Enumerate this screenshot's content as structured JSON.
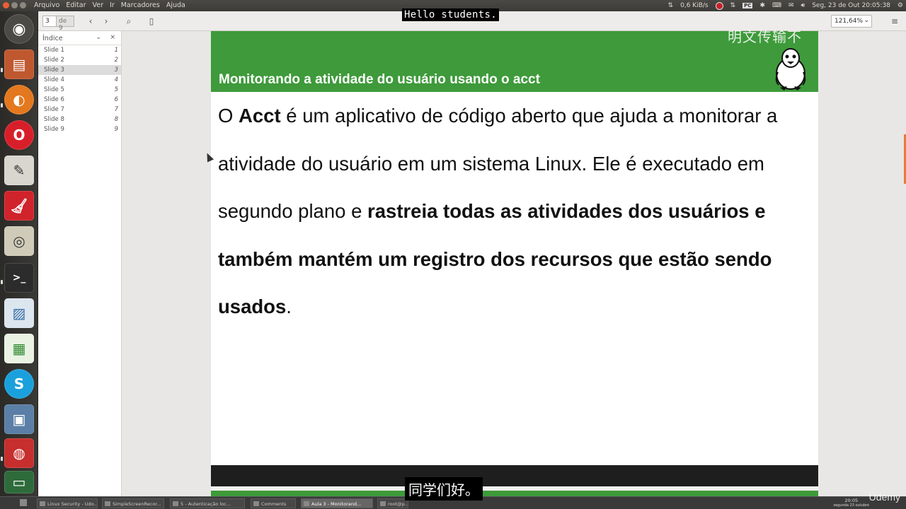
{
  "top_panel": {
    "menu": [
      "Arquivo",
      "Editar",
      "Ver",
      "Ir",
      "Marcadores",
      "Ajuda"
    ],
    "net_speed": "0,6 KiB/s",
    "clock": "Seg, 23 de Out 20:05:38"
  },
  "subtitles": {
    "top": "Hello students.",
    "bottom": "同学们好。"
  },
  "watermark": "明文传输不",
  "toolbar": {
    "page_current": "3",
    "page_total": "de 9",
    "zoom": "121,64%"
  },
  "sidebar": {
    "title": "Índice",
    "items": [
      {
        "label": "Slide 1",
        "page": "1"
      },
      {
        "label": "Slide 2",
        "page": "2"
      },
      {
        "label": "Slide 3",
        "page": "3"
      },
      {
        "label": "Slide 4",
        "page": "4"
      },
      {
        "label": "Slide 5",
        "page": "5"
      },
      {
        "label": "Slide 6",
        "page": "6"
      },
      {
        "label": "Slide 7",
        "page": "7"
      },
      {
        "label": "Slide 8",
        "page": "8"
      },
      {
        "label": "Slide 9",
        "page": "9"
      }
    ],
    "selected_index": 2
  },
  "slide": {
    "title": "Monitorando a atividade do usuário usando o acct",
    "p1": "O ",
    "p2": "Acct",
    "p3": " é um aplicativo de código aberto que ajuda a monitorar a atividade do usuário em um sistema Linux. Ele é executado em segundo plano e ",
    "p4": "rastreia todas as atividades dos usuários e também mantém um registro dos recursos que estão sendo usados",
    "p5": ".",
    "header_color": "#3e9a3a"
  },
  "taskbar": {
    "tasks": [
      "Linux Security - Udo...",
      "SimpleScreenRecor...",
      "5 - Autenticação loc...",
      "Comments",
      "Aula 3 - Monitorand...",
      "root@p..."
    ],
    "active_index": 4,
    "time": "20:05",
    "date": "segunda 23 outubro"
  },
  "brand": "Udemy"
}
